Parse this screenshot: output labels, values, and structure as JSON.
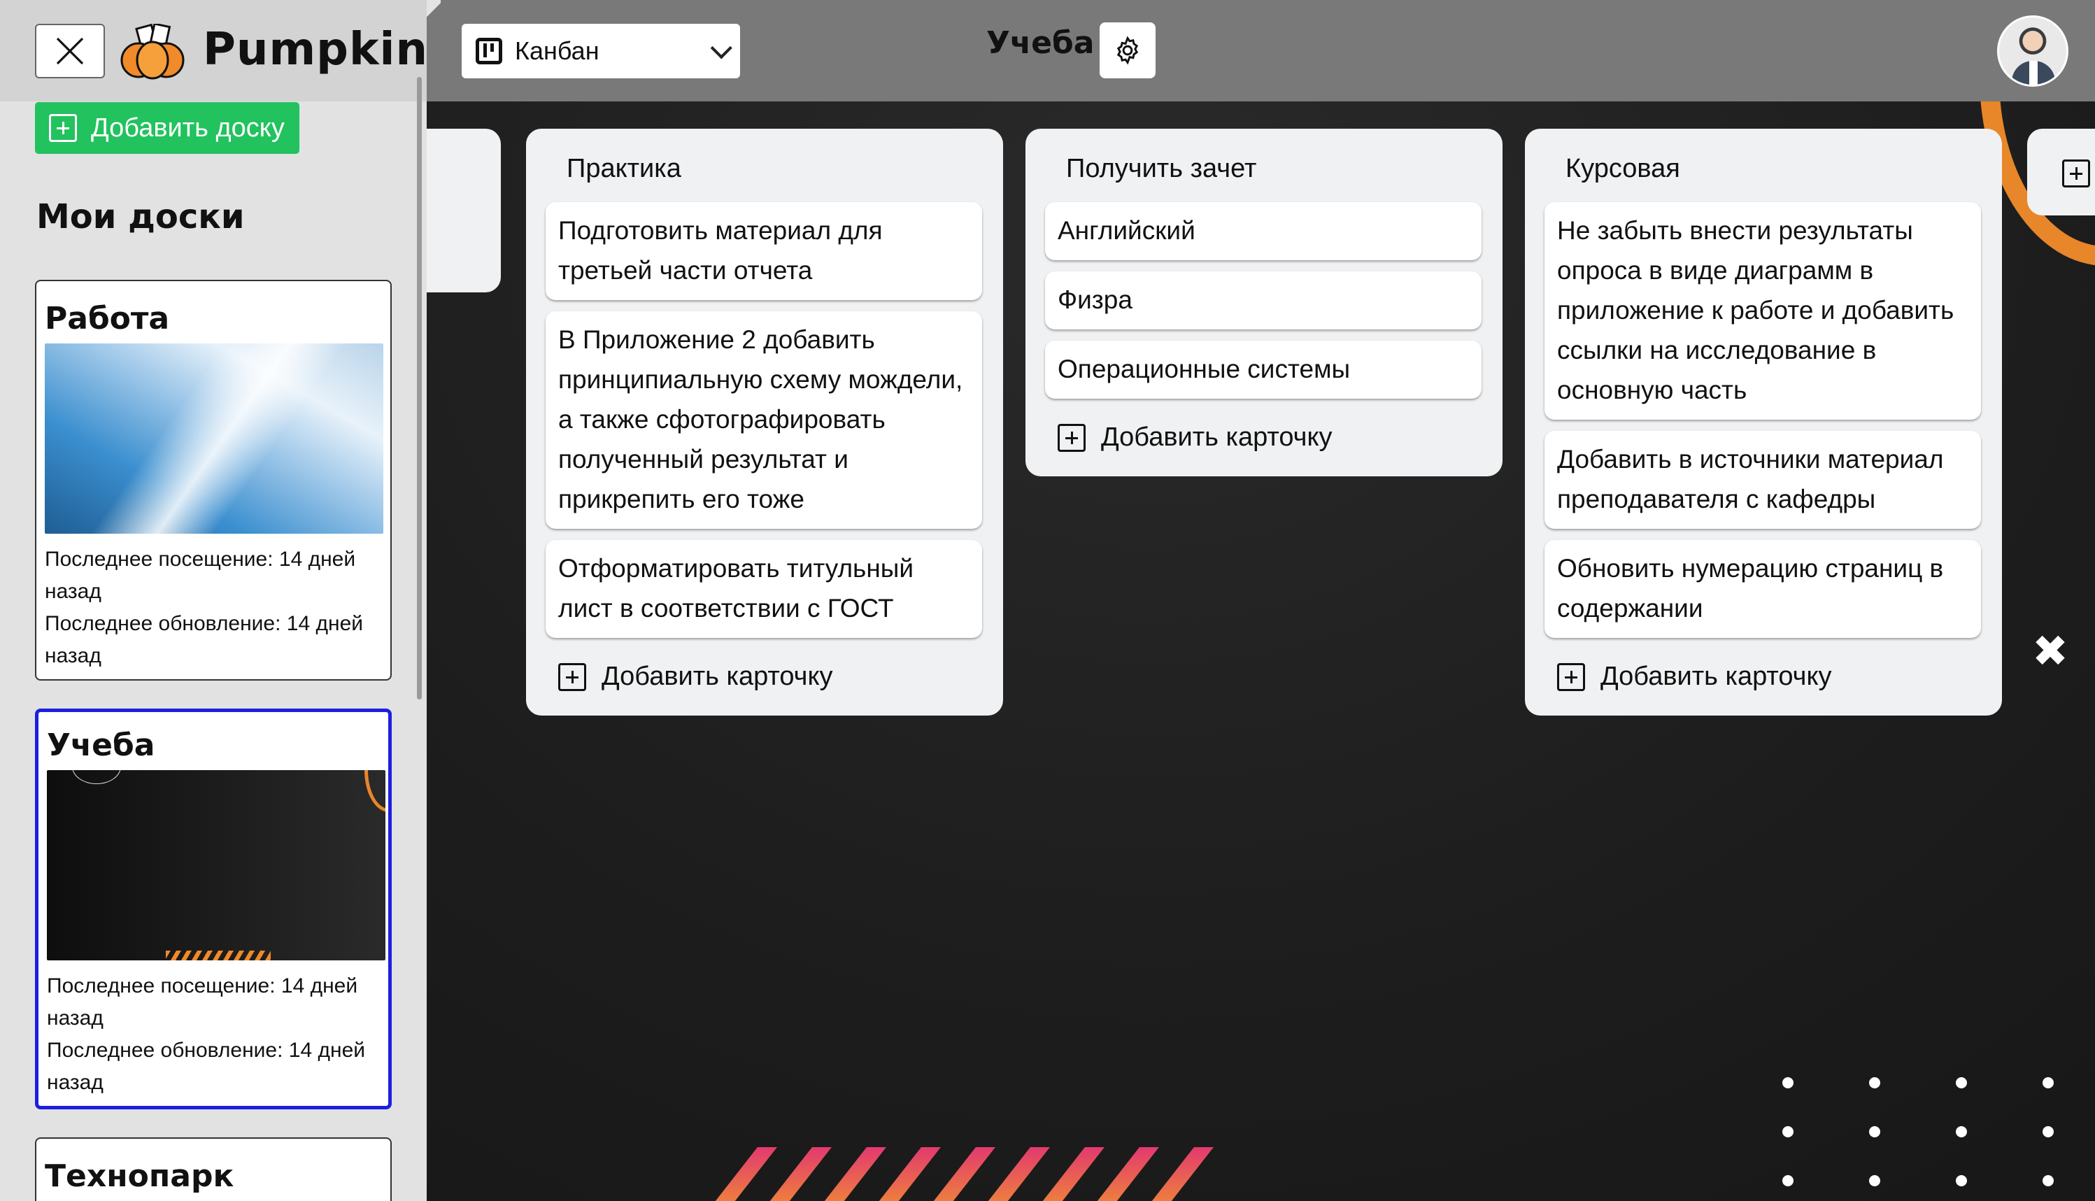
{
  "app": {
    "name": "Pumpkin"
  },
  "header": {
    "view_select": {
      "value": "Канбан"
    },
    "board_title": "Учеба"
  },
  "sidebar": {
    "add_board_label": "Добавить доску",
    "heading": "Мои доски",
    "boards": [
      {
        "title": "Работа",
        "last_visit": "Последнее посещение: 14 дней назад",
        "last_update": "Последнее обновление: 14 дней назад",
        "selected": false
      },
      {
        "title": "Учеба",
        "last_visit": "Последнее посещение: 14 дней назад",
        "last_update": "Последнее обновление: 14 дней назад",
        "selected": true
      },
      {
        "title": "Технопарк"
      }
    ]
  },
  "columns": [
    {
      "title": "Практика",
      "cards": [
        "Подготовить материал для третьей части отчета",
        "В Приложение 2 добавить принципиальную схему мождели, а также сфотографировать полученный результат и прикрепить его тоже",
        "Отформатировать титульный лист в соответствии с ГОСТ"
      ],
      "add_label": "Добавить карточку"
    },
    {
      "title": "Получить зачет",
      "cards": [
        "Английский",
        "Физра",
        "Операционные системы"
      ],
      "add_label": "Добавить карточку"
    },
    {
      "title": "Курсовая",
      "cards": [
        "Не забыть внести результаты опроса в виде диаграмм в приложение к работе и добавить ссылки на исследование в основную часть",
        "Добавить в источники материал преподавателя с кафедры",
        "Обновить нумерацию страниц в содержании"
      ],
      "add_label": "Добавить карточку"
    }
  ],
  "colors": {
    "accent_green": "#22c25e",
    "selected_border": "#1c1fe0",
    "header_bg": "#797979",
    "orange": "#e8862a"
  }
}
